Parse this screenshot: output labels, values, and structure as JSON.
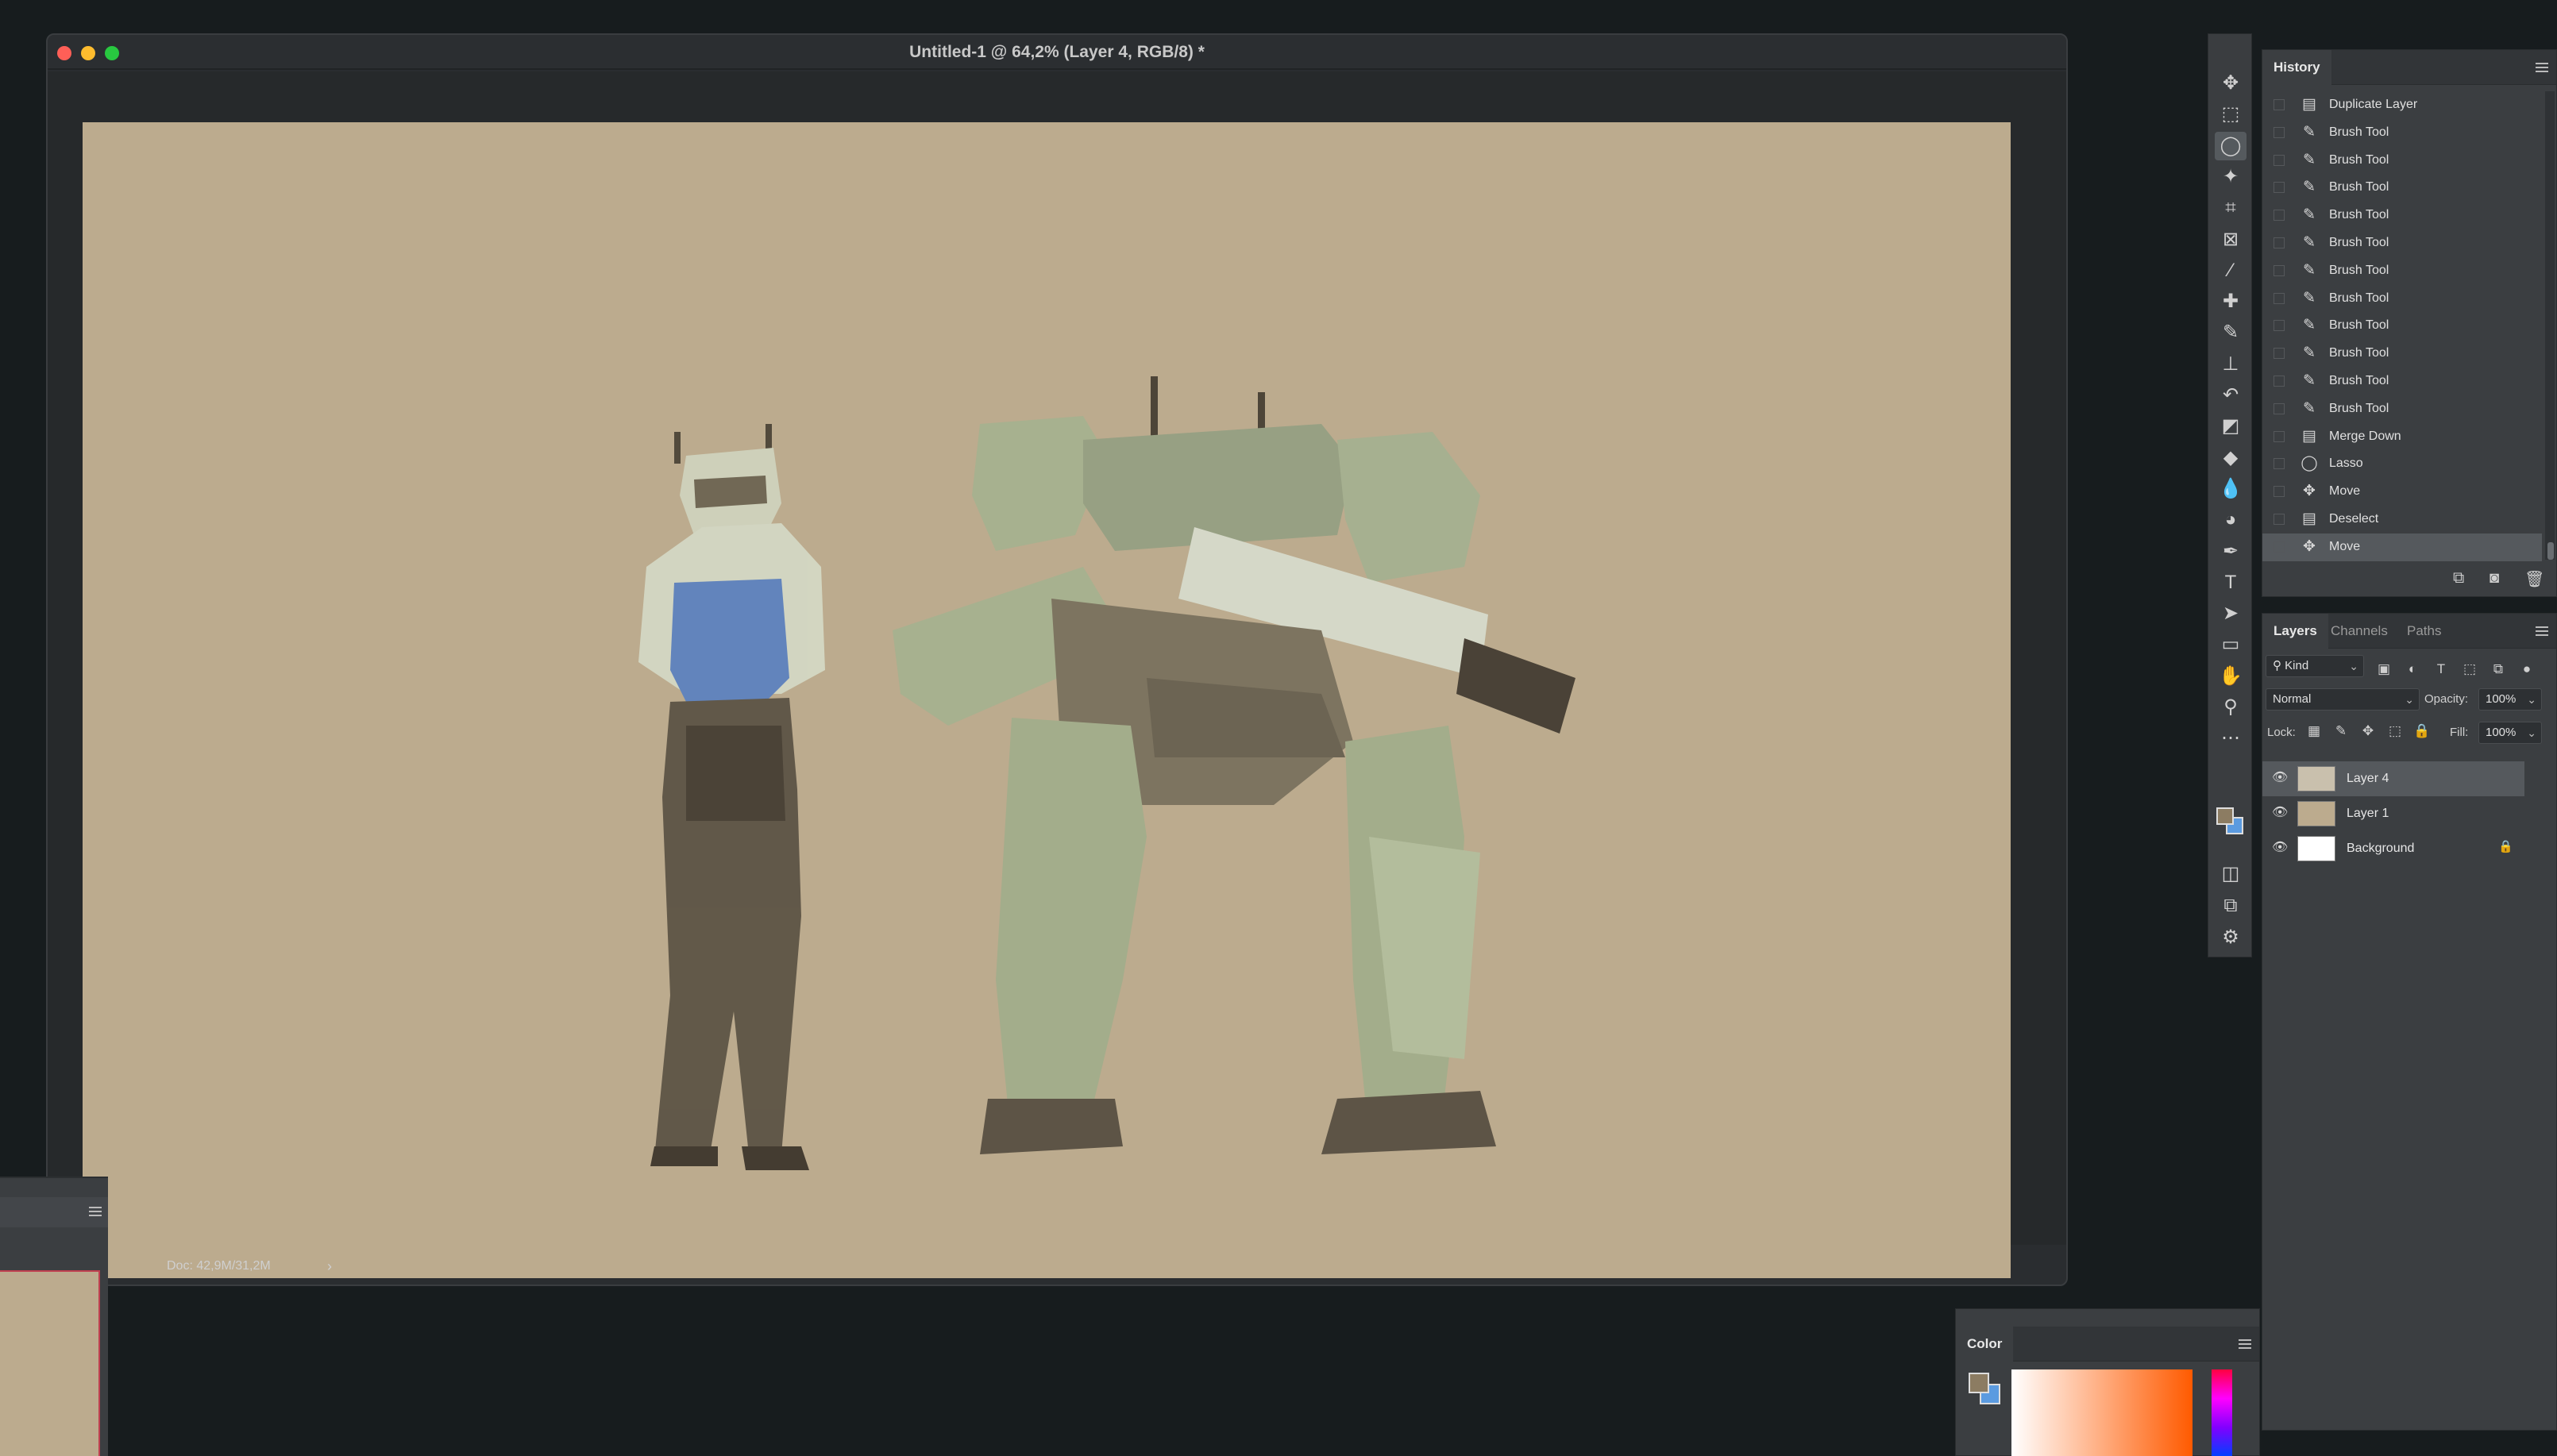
{
  "document": {
    "title": "Untitled-1 @ 64,2% (Layer 4, RGB/8) *",
    "status": "Doc: 42,9M/31,2M",
    "canvas_color": "#bcab8e"
  },
  "toolbar": {
    "tools": [
      {
        "name": "move-tool-icon",
        "glyph": "✥"
      },
      {
        "name": "rectangular-marquee-icon",
        "glyph": "⬚"
      },
      {
        "name": "lasso-tool-icon",
        "glyph": "◯",
        "active": true
      },
      {
        "name": "magic-wand-icon",
        "glyph": "✦"
      },
      {
        "name": "crop-tool-icon",
        "glyph": "⌗"
      },
      {
        "name": "frame-tool-icon",
        "glyph": "⊠"
      },
      {
        "name": "eyedropper-icon",
        "glyph": "⁄"
      },
      {
        "name": "healing-brush-icon",
        "glyph": "✚"
      },
      {
        "name": "brush-tool-icon",
        "glyph": "✎"
      },
      {
        "name": "clone-stamp-icon",
        "glyph": "⊥"
      },
      {
        "name": "history-brush-icon",
        "glyph": "↶"
      },
      {
        "name": "eraser-icon",
        "glyph": "◩"
      },
      {
        "name": "paint-bucket-icon",
        "glyph": "◆"
      },
      {
        "name": "blur-tool-icon",
        "glyph": "💧"
      },
      {
        "name": "dodge-tool-icon",
        "glyph": "◕"
      },
      {
        "name": "pen-tool-icon",
        "glyph": "✒"
      },
      {
        "name": "type-tool-icon",
        "glyph": "T"
      },
      {
        "name": "path-selection-icon",
        "glyph": "➤"
      },
      {
        "name": "rectangle-tool-icon",
        "glyph": "▭"
      },
      {
        "name": "hand-tool-icon",
        "glyph": "✋"
      },
      {
        "name": "zoom-tool-icon",
        "glyph": "⚲"
      },
      {
        "name": "more-tools-icon",
        "glyph": "⋯"
      }
    ]
  },
  "history": {
    "tab": "History",
    "items": [
      {
        "label": "Duplicate Layer",
        "icon": "document-icon"
      },
      {
        "label": "Brush Tool",
        "icon": "brush-icon"
      },
      {
        "label": "Brush Tool",
        "icon": "brush-icon"
      },
      {
        "label": "Brush Tool",
        "icon": "brush-icon"
      },
      {
        "label": "Brush Tool",
        "icon": "brush-icon"
      },
      {
        "label": "Brush Tool",
        "icon": "brush-icon"
      },
      {
        "label": "Brush Tool",
        "icon": "brush-icon"
      },
      {
        "label": "Brush Tool",
        "icon": "brush-icon"
      },
      {
        "label": "Brush Tool",
        "icon": "brush-icon"
      },
      {
        "label": "Brush Tool",
        "icon": "brush-icon"
      },
      {
        "label": "Brush Tool",
        "icon": "brush-icon"
      },
      {
        "label": "Brush Tool",
        "icon": "brush-icon"
      },
      {
        "label": "Merge Down",
        "icon": "document-icon"
      },
      {
        "label": "Lasso",
        "icon": "lasso-icon"
      },
      {
        "label": "Move",
        "icon": "move-icon"
      },
      {
        "label": "Deselect",
        "icon": "document-icon"
      },
      {
        "label": "Move",
        "icon": "move-icon",
        "selected": true
      }
    ]
  },
  "layers_panel": {
    "tabs": [
      "Layers",
      "Channels",
      "Paths"
    ],
    "filter_kind": "Kind",
    "blend_mode": "Normal",
    "opacity_label": "Opacity:",
    "opacity_value": "100%",
    "lock_label": "Lock:",
    "fill_label": "Fill:",
    "fill_value": "100%",
    "layers": [
      {
        "name": "Layer 4",
        "selected": true,
        "thumb": "#c9c0ad"
      },
      {
        "name": "Layer 1",
        "selected": false,
        "thumb": "#bcab8e"
      },
      {
        "name": "Background",
        "selected": false,
        "thumb": "#ffffff",
        "locked": true
      }
    ]
  },
  "color_panel": {
    "tab": "Color",
    "foreground": "#8c7c62",
    "background": "#5b9be0"
  }
}
